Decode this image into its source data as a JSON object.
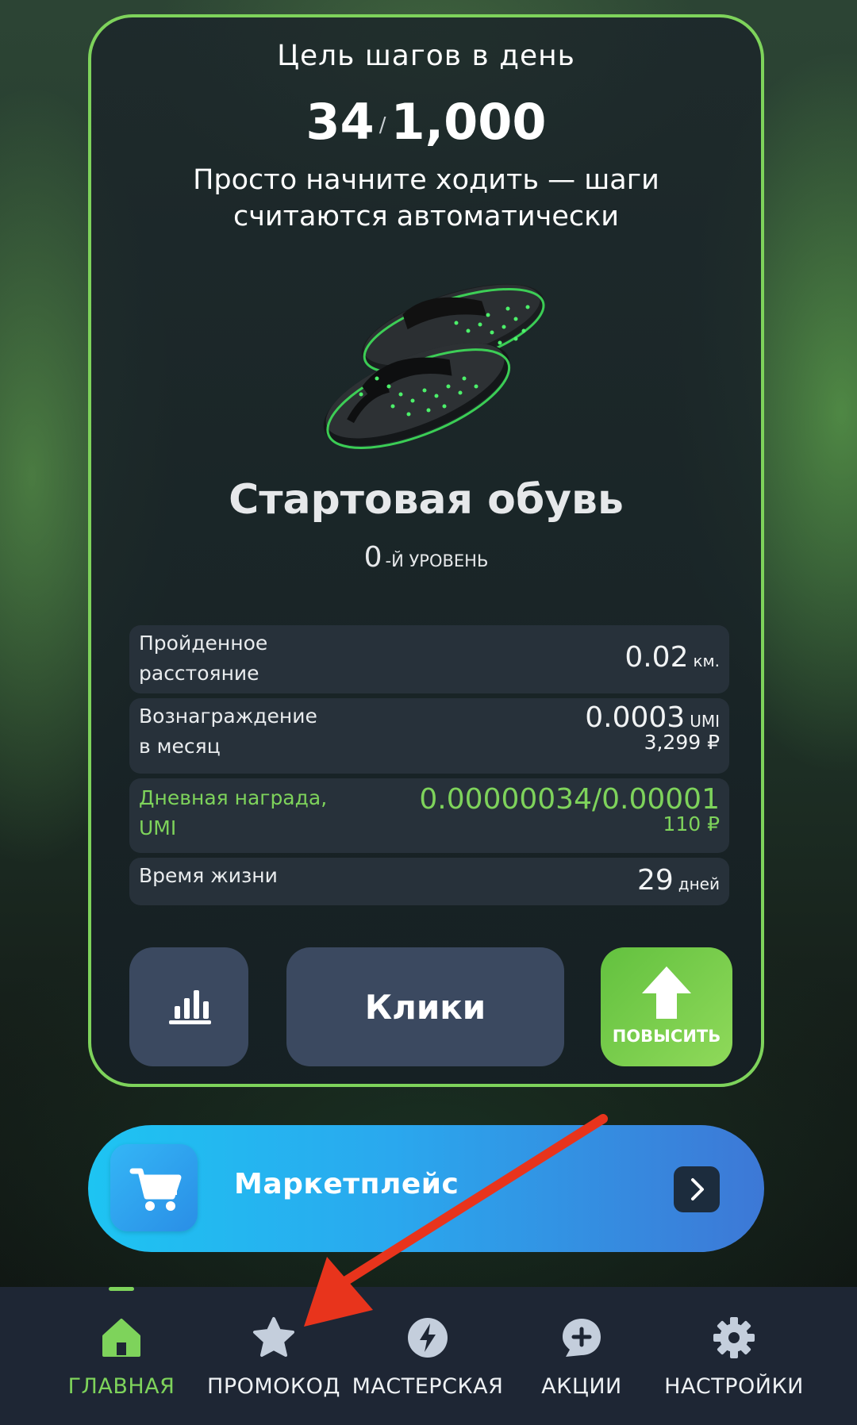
{
  "card": {
    "goal_title": "Цель шагов в день",
    "steps_current": "34",
    "steps_separator": "/",
    "steps_goal": "1,000",
    "subtitle": "Просто начните ходить — шаги считаются автоматически",
    "shoe_name": "Стартовая обувь",
    "level_value": "0",
    "level_suffix": "-Й УРОВЕНЬ",
    "stats": {
      "distance": {
        "label_line1": "Пройденное",
        "label_line2": "расстояние",
        "value": "0.02",
        "unit": "км."
      },
      "monthly": {
        "label_line1": "Вознаграждение",
        "label_line2": "в месяц",
        "value": "0.0003",
        "unit": "UMI",
        "rub": "3,299 ₽"
      },
      "daily": {
        "label_line1": "Дневная награда,",
        "label_line2": "UMI",
        "value": "0.00000034/0.00001",
        "rub": "110 ₽"
      },
      "lifetime": {
        "label": "Время жизни",
        "value": "29",
        "unit": "дней"
      }
    },
    "buttons": {
      "clicks": "Клики",
      "upgrade": "ПОВЫСИТЬ"
    }
  },
  "marketplace": {
    "label": "Маркетплейс"
  },
  "nav": [
    {
      "label": "ГЛАВНАЯ",
      "icon": "home-icon",
      "active": true
    },
    {
      "label": "ПРОМОКОД",
      "icon": "star-icon"
    },
    {
      "label": "МАСТЕРСКАЯ",
      "icon": "lightning-icon"
    },
    {
      "label": "АКЦИИ",
      "icon": "chat-plus-icon"
    },
    {
      "label": "НАСТРОЙКИ",
      "icon": "gear-icon"
    }
  ],
  "colors": {
    "accent_green": "#7ed35b",
    "nav_bg": "#1e2634",
    "button_bg": "#3b4960",
    "annotation_arrow": "#e8341c"
  }
}
